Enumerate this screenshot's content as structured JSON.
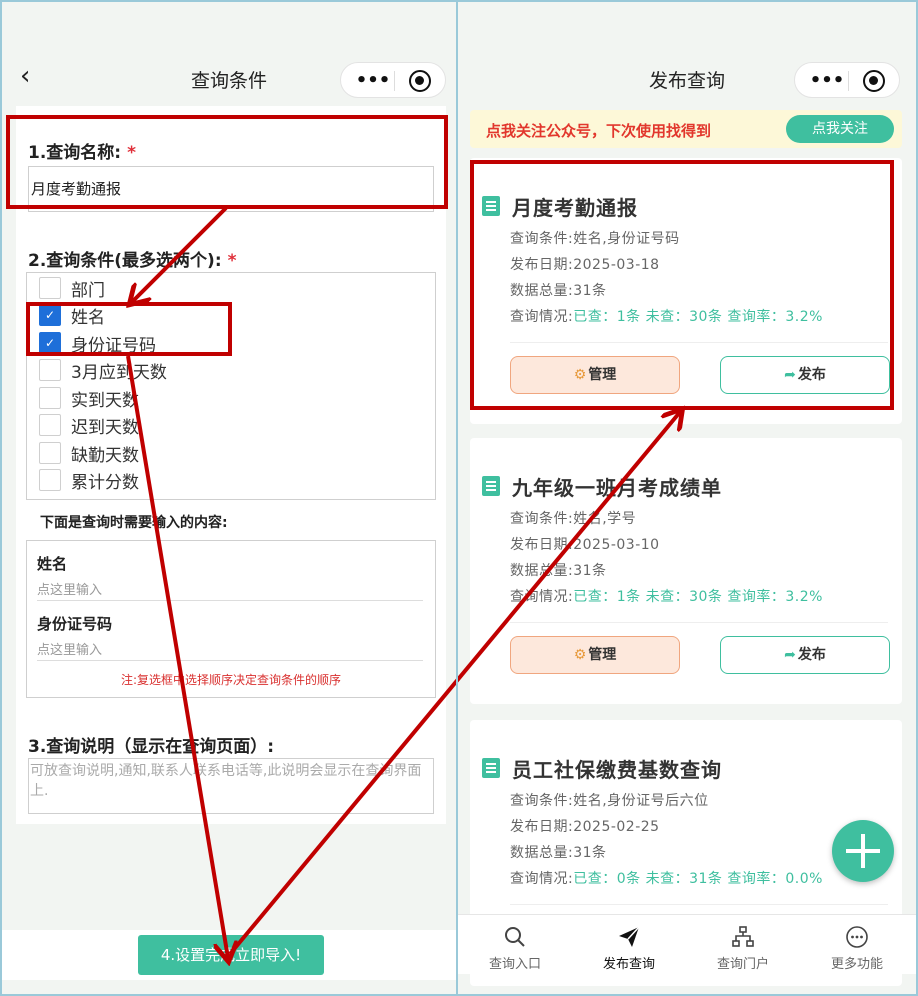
{
  "left": {
    "nav": {
      "title": "查询条件"
    },
    "form": {
      "name_label": "1.查询名称:",
      "name_value": "月度考勤通报",
      "cond_label": "2.查询条件(最多选两个):",
      "required_mark": "*",
      "options": [
        {
          "label": "部门",
          "checked": false
        },
        {
          "label": "姓名",
          "checked": true
        },
        {
          "label": "身份证号码",
          "checked": true
        },
        {
          "label": "3月应到天数",
          "checked": false
        },
        {
          "label": "实到天数",
          "checked": false
        },
        {
          "label": "迟到天数",
          "checked": false
        },
        {
          "label": "缺勤天数",
          "checked": false
        },
        {
          "label": "累计分数",
          "checked": false
        }
      ],
      "inputs_heading": "下面是查询时需要输入的内容:",
      "fields": [
        {
          "label": "姓名",
          "placeholder": "点这里输入"
        },
        {
          "label": "身份证号码",
          "placeholder": "点这里输入"
        }
      ],
      "order_note": "注:复选框中选择顺序决定查询条件的顺序",
      "desc_label": "3.查询说明（显示在查询页面）:",
      "desc_placeholder": "可放查询说明,通知,联系人联系电话等,此说明会显示在查询界面上."
    },
    "import_button": "4.设置完成立即导入!"
  },
  "right": {
    "nav": {
      "title": "发布查询"
    },
    "follow": {
      "message": "点我关注公众号，下次使用找得到",
      "button": "点我关注"
    },
    "row_labels": {
      "conditions": "查询条件:",
      "date": "发布日期:",
      "total": "数据总量:",
      "status": "查询情况:"
    },
    "cards": [
      {
        "title": "月度考勤通报",
        "conditions": "姓名,身份证号码",
        "date": "2025-03-18",
        "total": "31条",
        "status": "已查：1条 未查：30条 查询率：3.2%"
      },
      {
        "title": "九年级一班月考成绩单",
        "conditions": "姓名,学号",
        "date": "2025-03-10",
        "total": "31条",
        "status": "已查：1条 未查：30条 查询率：3.2%"
      },
      {
        "title": "员工社保缴费基数查询",
        "conditions": "姓名,身份证号后六位",
        "date": "2025-02-25",
        "total": "31条",
        "status": "已查：0条 未查：31条 查询率：0.0%"
      }
    ],
    "manage_label": "管理",
    "publish_label": "发布",
    "tabs": [
      {
        "label": "查询入口",
        "icon": "search-icon"
      },
      {
        "label": "发布查询",
        "icon": "send-icon",
        "active": true
      },
      {
        "label": "查询门户",
        "icon": "sitemap-icon"
      },
      {
        "label": "更多功能",
        "icon": "more-icon"
      }
    ]
  },
  "colors": {
    "accent": "#3fbf9f",
    "annotation": "#c00000",
    "warning_text": "#e2372d",
    "checkbox": "#1e6fd9"
  }
}
